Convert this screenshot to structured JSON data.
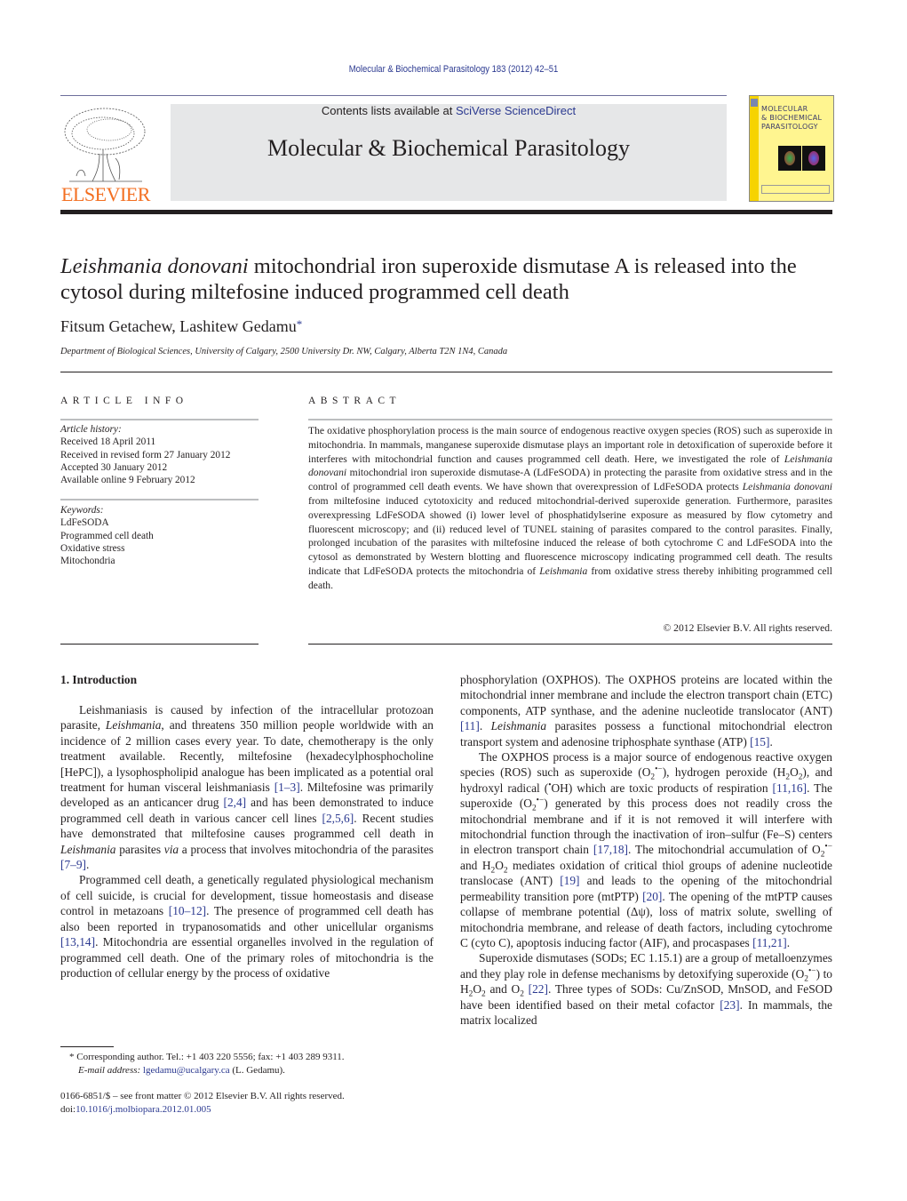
{
  "header": {
    "journal_ref": "Molecular & Biochemical Parasitology 183 (2012) 42–51",
    "contents_prefix": "Contents lists available at ",
    "contents_link": "SciVerse ScienceDirect",
    "journal_name": "Molecular & Biochemical Parasitology",
    "publisher_logo_text": "ELSEVIER",
    "cover_title_lines": [
      "MOLECULAR",
      "& BIOCHEMICAL",
      "PARASITOLOGY"
    ]
  },
  "colors": {
    "link": "#2b3990",
    "elsevier_orange": "#f36f21",
    "banner_gray": "#e6e7e8",
    "cover_yellow": "#fff590"
  },
  "article": {
    "title_italic": "Leishmania donovani",
    "title_rest": " mitochondrial iron superoxide dismutase A is released into the cytosol during miltefosine induced programmed cell death",
    "authors": "Fitsum Getachew, Lashitew Gedamu",
    "author_marker": "*",
    "affiliation": "Department of Biological Sciences, University of Calgary, 2500 University Dr. NW, Calgary, Alberta T2N 1N4, Canada"
  },
  "article_info": {
    "heading": "ARTICLE INFO",
    "history_label": "Article history:",
    "history": [
      "Received 18 April 2011",
      "Received in revised form 27 January 2012",
      "Accepted 30 January 2012",
      "Available online 9 February 2012"
    ],
    "keywords_label": "Keywords:",
    "keywords": [
      "LdFeSODA",
      "Programmed cell death",
      "Oxidative stress",
      "Mitochondria"
    ]
  },
  "abstract": {
    "heading": "ABSTRACT",
    "p1": "The oxidative phosphorylation process is the main source of endogenous reactive oxygen species (ROS) such as superoxide in mitochondria. In mammals, manganese superoxide dismutase plays an important role in detoxification of superoxide before it interferes with mitochondrial function and causes programmed cell death. Here, we investigated the role of ",
    "i1": "Leishmania donovani",
    "p2": " mitochondrial iron superoxide dismutase-A (LdFeSODA) in protecting the parasite from oxidative stress and in the control of programmed cell death events. We have shown that overexpression of LdFeSODA protects ",
    "i2": "Leishmania donovani",
    "p3": " from miltefosine induced cytotoxicity and reduced mitochondrial-derived superoxide generation. Furthermore, parasites overexpressing LdFeSODA showed (i) lower level of phosphatidylserine exposure as measured by flow cytometry and fluorescent microscopy; and (ii) reduced level of TUNEL staining of parasites compared to the control parasites. Finally, prolonged incubation of the parasites with miltefosine induced the release of both cytochrome C and LdFeSODA into the cytosol as demonstrated by Western blotting and fluorescence microscopy indicating programmed cell death. The results indicate that LdFeSODA protects the mitochondria of ",
    "i3": "Leishmania",
    "p4": " from oxidative stress thereby inhibiting programmed cell death.",
    "copyright": "© 2012 Elsevier B.V. All rights reserved."
  },
  "intro": {
    "heading": "1.  Introduction",
    "left": {
      "a1": "Leishmaniasis is caused by infection of the intracellular protozoan parasite, ",
      "a1i": "Leishmania",
      "a2": ", and threatens 350 million people worldwide with an incidence of 2 million cases every year. To date, chemotherapy is the only treatment available. Recently, miltefosine (hexadecylphosphocholine [HePC]), a lysophospholipid analogue has been implicated as a potential oral treatment for human visceral leishmaniasis ",
      "r1": "[1–3]",
      "a3": ". Miltefosine was primarily developed as an anticancer drug ",
      "r2": "[2,4]",
      "a4": " and has been demonstrated to induce programmed cell death in various cancer cell lines ",
      "r3": "[2,5,6]",
      "a5": ". Recent studies have demonstrated that miltefosine causes programmed cell death in ",
      "a5i": "Leishmania",
      "a6": " parasites ",
      "a6i": "via",
      "a7": " a process that involves mitochondria of the parasites ",
      "r4": "[7–9]",
      "a8": ".",
      "b1": "Programmed cell death, a genetically regulated physiological mechanism of cell suicide, is crucial for development, tissue homeostasis and disease control in metazoans ",
      "r5": "[10–12]",
      "b2": ". The presence of programmed cell death has also been reported in trypanosomatids and other unicellular organisms ",
      "r6": "[13,14]",
      "b3": ". Mitochondria are essential organelles involved in the regulation of programmed cell death. One of the primary roles of mitochondria is the production of cellular energy by the process of oxidative"
    },
    "right": {
      "c1": "phosphorylation (OXPHOS). The OXPHOS proteins are located within the mitochondrial inner membrane and include the electron transport chain (ETC) components, ATP synthase, and the adenine nucleotide translocator (ANT) ",
      "r7": "[11]",
      "c2": ". ",
      "c2i": "Leishmania",
      "c3": " parasites possess a functional mitochondrial electron transport system and adenosine triphosphate synthase (ATP) ",
      "r8": "[15]",
      "c4": ".",
      "d1": "The OXPHOS process is a major source of endogenous reactive oxygen species (ROS) such as superoxide (O",
      "d2": "), hydrogen peroxide (H",
      "d3": "), and hydroxyl radical (",
      "d4": "OH) which are toxic products of respiration ",
      "r9": "[11,16]",
      "d5": ". The superoxide (O",
      "d6": ") generated by this process does not readily cross the mitochondrial membrane and if it is not removed it will interfere with mitochondrial function through the inactivation of iron–sulfur (Fe–S) centers in electron transport chain ",
      "r10": "[17,18]",
      "d7": ". The mitochondrial accumulation of O",
      "d8": " and H",
      "d9": " mediates oxidation of critical thiol groups of adenine nucleotide translocase (ANT) ",
      "r11": "[19]",
      "d10": " and leads to the opening of the mitochondrial permeability transition pore (mtPTP) ",
      "r12": "[20]",
      "d11": ". The opening of the mtPTP causes collapse of membrane potential (Δψ), loss of matrix solute, swelling of mitochondria membrane, and release of death factors, including cytochrome C (cyto C), apoptosis inducing factor (AIF), and procaspases ",
      "r13": "[11,21]",
      "d12": ".",
      "e1": "Superoxide dismutases (SODs; EC 1.15.1) are a group of metalloenzymes and they play role in defense mechanisms by detoxifying superoxide (O",
      "e2": ") to H",
      "e3": " and O",
      "r14": "[22]",
      "e4": ". Three types of SODs: Cu/ZnSOD, MnSOD, and FeSOD have been identified based on their metal cofactor ",
      "r15": "[23]",
      "e5": ". In mammals, the matrix localized",
      "sub2": "2",
      "sup_rad": "•−",
      "sup_dot": "•"
    }
  },
  "footnote": {
    "marker": "*",
    "corresponding": "Corresponding author. Tel.: +1 403 220 5556; fax: +1 403 289 9311.",
    "email_label": "E-mail address:",
    "email": "lgedamu@ucalgary.ca",
    "email_suffix": " (L. Gedamu)."
  },
  "front_matter": {
    "issn_line": "0166-6851/$ – see front matter © 2012 Elsevier B.V. All rights reserved.",
    "doi_prefix": "doi:",
    "doi": "10.1016/j.molbiopara.2012.01.005"
  }
}
